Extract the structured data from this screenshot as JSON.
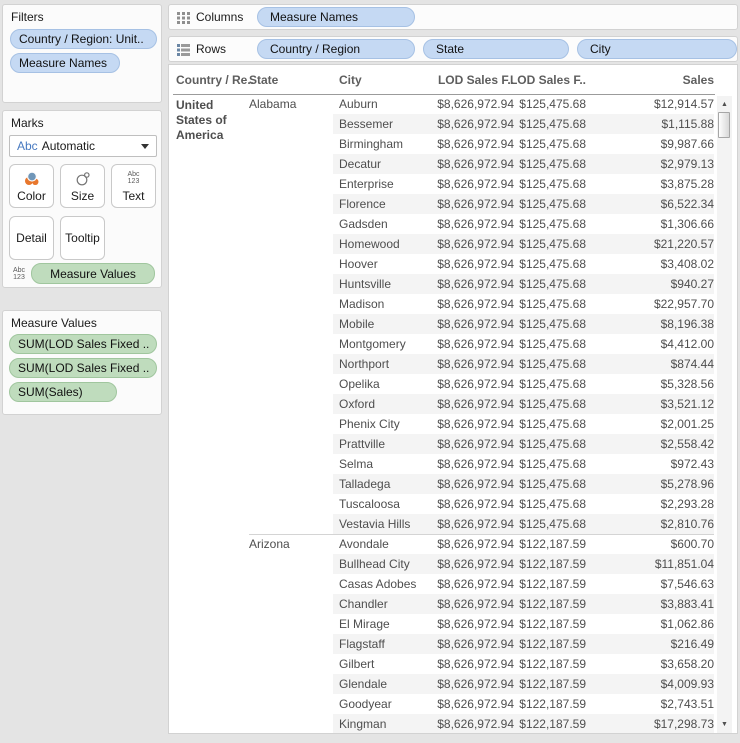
{
  "sidebar": {
    "filters": {
      "title": "Filters",
      "pills": [
        {
          "label": "Country / Region: Unit.."
        },
        {
          "label": "Measure Names"
        }
      ]
    },
    "marks": {
      "title": "Marks",
      "mark_type_icon": "Abc",
      "mark_type": "Automatic",
      "buttons": [
        {
          "label": "Color"
        },
        {
          "label": "Size"
        },
        {
          "label": "Text"
        },
        {
          "label": "Detail"
        },
        {
          "label": "Tooltip"
        }
      ],
      "icon_abc": "Abc",
      "icon_123": "123",
      "encoding_pill": "Measure Values"
    },
    "measure_values": {
      "title": "Measure Values",
      "pills": [
        {
          "label": "SUM(LOD Sales Fixed .."
        },
        {
          "label": "SUM(LOD Sales Fixed .."
        },
        {
          "label": "SUM(Sales)"
        }
      ]
    }
  },
  "shelves": {
    "columns": {
      "label": "Columns",
      "pills": [
        {
          "label": "Measure Names"
        }
      ]
    },
    "rows": {
      "label": "Rows",
      "pills": [
        {
          "label": "Country / Region"
        },
        {
          "label": "State"
        },
        {
          "label": "City"
        }
      ]
    }
  },
  "table": {
    "headers": [
      "Country / Re..",
      "State",
      "City",
      "LOD Sales F..",
      "LOD Sales F..",
      "Sales"
    ],
    "country": "United States of America",
    "groups": [
      {
        "state": "Alabama",
        "rows": [
          {
            "city": "Auburn",
            "lod1": "$8,626,972.94",
            "lod2": "$125,475.68",
            "sales": "$12,914.57"
          },
          {
            "city": "Bessemer",
            "lod1": "$8,626,972.94",
            "lod2": "$125,475.68",
            "sales": "$1,115.88"
          },
          {
            "city": "Birmingham",
            "lod1": "$8,626,972.94",
            "lod2": "$125,475.68",
            "sales": "$9,987.66"
          },
          {
            "city": "Decatur",
            "lod1": "$8,626,972.94",
            "lod2": "$125,475.68",
            "sales": "$2,979.13"
          },
          {
            "city": "Enterprise",
            "lod1": "$8,626,972.94",
            "lod2": "$125,475.68",
            "sales": "$3,875.28"
          },
          {
            "city": "Florence",
            "lod1": "$8,626,972.94",
            "lod2": "$125,475.68",
            "sales": "$6,522.34"
          },
          {
            "city": "Gadsden",
            "lod1": "$8,626,972.94",
            "lod2": "$125,475.68",
            "sales": "$1,306.66"
          },
          {
            "city": "Homewood",
            "lod1": "$8,626,972.94",
            "lod2": "$125,475.68",
            "sales": "$21,220.57"
          },
          {
            "city": "Hoover",
            "lod1": "$8,626,972.94",
            "lod2": "$125,475.68",
            "sales": "$3,408.02"
          },
          {
            "city": "Huntsville",
            "lod1": "$8,626,972.94",
            "lod2": "$125,475.68",
            "sales": "$940.27"
          },
          {
            "city": "Madison",
            "lod1": "$8,626,972.94",
            "lod2": "$125,475.68",
            "sales": "$22,957.70"
          },
          {
            "city": "Mobile",
            "lod1": "$8,626,972.94",
            "lod2": "$125,475.68",
            "sales": "$8,196.38"
          },
          {
            "city": "Montgomery",
            "lod1": "$8,626,972.94",
            "lod2": "$125,475.68",
            "sales": "$4,412.00"
          },
          {
            "city": "Northport",
            "lod1": "$8,626,972.94",
            "lod2": "$125,475.68",
            "sales": "$874.44"
          },
          {
            "city": "Opelika",
            "lod1": "$8,626,972.94",
            "lod2": "$125,475.68",
            "sales": "$5,328.56"
          },
          {
            "city": "Oxford",
            "lod1": "$8,626,972.94",
            "lod2": "$125,475.68",
            "sales": "$3,521.12"
          },
          {
            "city": "Phenix City",
            "lod1": "$8,626,972.94",
            "lod2": "$125,475.68",
            "sales": "$2,001.25"
          },
          {
            "city": "Prattville",
            "lod1": "$8,626,972.94",
            "lod2": "$125,475.68",
            "sales": "$2,558.42"
          },
          {
            "city": "Selma",
            "lod1": "$8,626,972.94",
            "lod2": "$125,475.68",
            "sales": "$972.43"
          },
          {
            "city": "Talladega",
            "lod1": "$8,626,972.94",
            "lod2": "$125,475.68",
            "sales": "$5,278.96"
          },
          {
            "city": "Tuscaloosa",
            "lod1": "$8,626,972.94",
            "lod2": "$125,475.68",
            "sales": "$2,293.28"
          },
          {
            "city": "Vestavia Hills",
            "lod1": "$8,626,972.94",
            "lod2": "$125,475.68",
            "sales": "$2,810.76"
          }
        ]
      },
      {
        "state": "Arizona",
        "rows": [
          {
            "city": "Avondale",
            "lod1": "$8,626,972.94",
            "lod2": "$122,187.59",
            "sales": "$600.70"
          },
          {
            "city": "Bullhead City",
            "lod1": "$8,626,972.94",
            "lod2": "$122,187.59",
            "sales": "$11,851.04"
          },
          {
            "city": "Casas Adobes",
            "lod1": "$8,626,972.94",
            "lod2": "$122,187.59",
            "sales": "$7,546.63"
          },
          {
            "city": "Chandler",
            "lod1": "$8,626,972.94",
            "lod2": "$122,187.59",
            "sales": "$3,883.41"
          },
          {
            "city": "El Mirage",
            "lod1": "$8,626,972.94",
            "lod2": "$122,187.59",
            "sales": "$1,062.86"
          },
          {
            "city": "Flagstaff",
            "lod1": "$8,626,972.94",
            "lod2": "$122,187.59",
            "sales": "$216.49"
          },
          {
            "city": "Gilbert",
            "lod1": "$8,626,972.94",
            "lod2": "$122,187.59",
            "sales": "$3,658.20"
          },
          {
            "city": "Glendale",
            "lod1": "$8,626,972.94",
            "lod2": "$122,187.59",
            "sales": "$4,009.93"
          },
          {
            "city": "Goodyear",
            "lod1": "$8,626,972.94",
            "lod2": "$122,187.59",
            "sales": "$2,743.51"
          },
          {
            "city": "Kingman",
            "lod1": "$8,626,972.94",
            "lod2": "$122,187.59",
            "sales": "$17,298.73"
          }
        ]
      }
    ]
  },
  "colors": {
    "pill_blue": "#C5D9F3",
    "pill_green": "#BFDCBD",
    "band": "#F4F4F4",
    "abc_blue": "#4779C0"
  }
}
